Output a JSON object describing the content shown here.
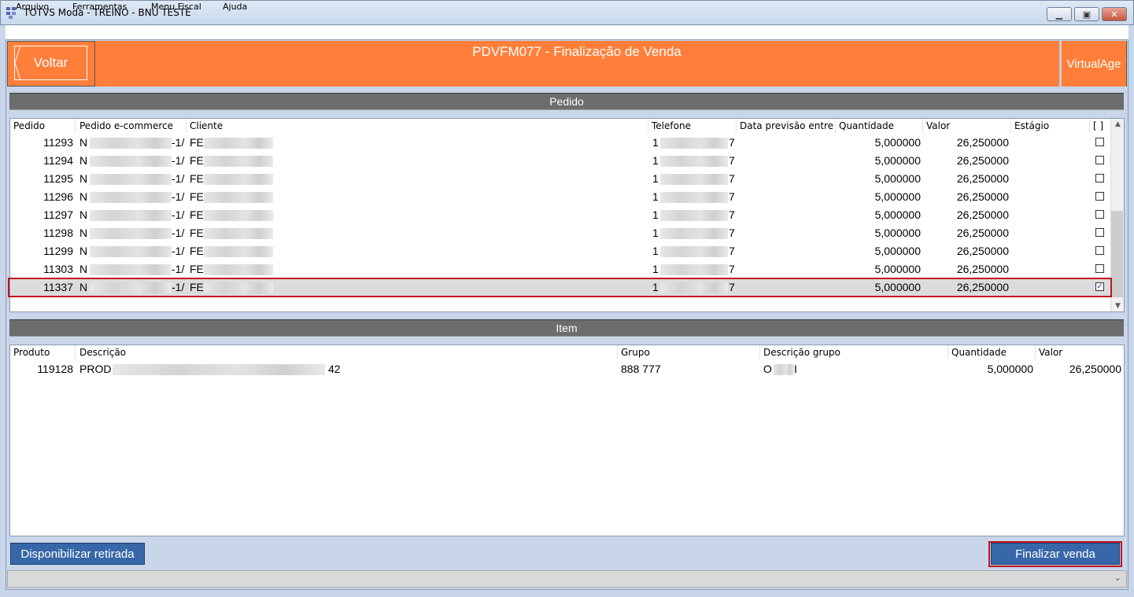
{
  "window": {
    "title": "TOTVS Moda - TREINO - BNU TESTE",
    "minimize_glyph": "▁",
    "maximize_glyph": "▣",
    "close_glyph": "✕"
  },
  "menu": [
    {
      "label": "Arquivo"
    },
    {
      "label": "Ferramentas"
    },
    {
      "label": "Menu Fiscal"
    },
    {
      "label": "Ajuda"
    }
  ],
  "header": {
    "back_label": "Voltar",
    "title": "PDVFM077 - Finalização de Venda",
    "brand": "VirtualAge",
    "accent_color": "#ff7f3a"
  },
  "pedido": {
    "section_label": "Pedido",
    "columns": [
      "Pedido",
      "Pedido e-commerce",
      "Cliente",
      "Telefone",
      "Data previsão entre",
      "Quantidade",
      "Valor",
      "Estágio",
      "[ ]"
    ],
    "rows": [
      {
        "pedido": "11293",
        "ecom_start": "N",
        "ecom_end": "-1/",
        "cliente": "FE",
        "tel_start": "1",
        "tel_end": "7",
        "quantidade": "5,000000",
        "valor": "26,250000",
        "checked": false
      },
      {
        "pedido": "11294",
        "ecom_start": "N",
        "ecom_end": "-1/",
        "cliente": "FE",
        "tel_start": "1",
        "tel_end": "7",
        "quantidade": "5,000000",
        "valor": "26,250000",
        "checked": false
      },
      {
        "pedido": "11295",
        "ecom_start": "N",
        "ecom_end": "-1/",
        "cliente": "FE",
        "tel_start": "1",
        "tel_end": "7",
        "quantidade": "5,000000",
        "valor": "26,250000",
        "checked": false
      },
      {
        "pedido": "11296",
        "ecom_start": "N",
        "ecom_end": "-1/",
        "cliente": "FE",
        "tel_start": "1",
        "tel_end": "7",
        "quantidade": "5,000000",
        "valor": "26,250000",
        "checked": false
      },
      {
        "pedido": "11297",
        "ecom_start": "N",
        "ecom_end": "-1/",
        "cliente": "FE",
        "tel_start": "1",
        "tel_end": "7",
        "quantidade": "5,000000",
        "valor": "26,250000",
        "checked": false
      },
      {
        "pedido": "11298",
        "ecom_start": "N",
        "ecom_end": "-1/",
        "cliente": "FE",
        "tel_start": "1",
        "tel_end": "7",
        "quantidade": "5,000000",
        "valor": "26,250000",
        "checked": false
      },
      {
        "pedido": "11299",
        "ecom_start": "N",
        "ecom_end": "-1/",
        "cliente": "FE",
        "tel_start": "1",
        "tel_end": "7",
        "quantidade": "5,000000",
        "valor": "26,250000",
        "checked": false
      },
      {
        "pedido": "11303",
        "ecom_start": "N",
        "ecom_end": "-1/",
        "cliente": "FE",
        "tel_start": "1",
        "tel_end": "7",
        "quantidade": "5,000000",
        "valor": "26,250000",
        "checked": false
      },
      {
        "pedido": "11337",
        "ecom_start": "N",
        "ecom_end": "-1/",
        "cliente": "FE",
        "tel_start": "1",
        "tel_end": "7",
        "quantidade": "5,000000",
        "valor": "26,250000",
        "checked": true
      }
    ]
  },
  "item": {
    "section_label": "Item",
    "columns": [
      "Produto",
      "Descrição",
      "Grupo",
      "Descrição grupo",
      "Quantidade",
      "Valor"
    ],
    "rows": [
      {
        "produto": "119128",
        "descricao_start": "PROD",
        "descricao_end": "42",
        "grupo": "888 777",
        "desc_grupo_start": "O",
        "desc_grupo_end": "I",
        "quantidade": "5,000000",
        "valor": "26,250000"
      }
    ]
  },
  "buttons": {
    "disponibilizar": "Disponibilizar retirada",
    "finalizar": "Finalizar venda"
  },
  "colors": {
    "button_blue": "#3767a8",
    "highlight_red": "#c1121f"
  }
}
